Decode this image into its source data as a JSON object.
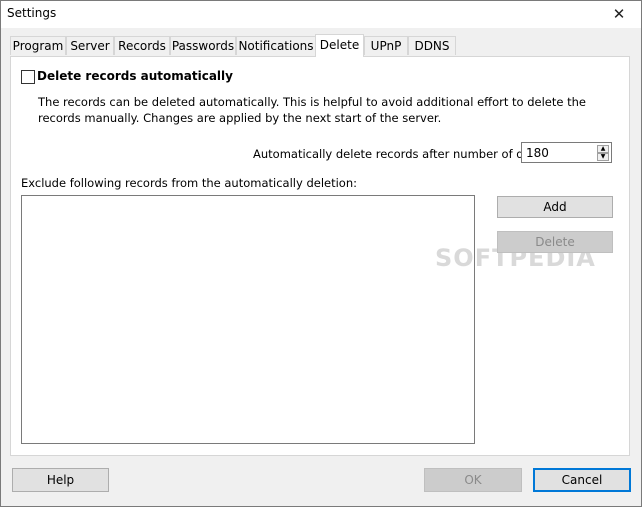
{
  "window": {
    "title": "Settings",
    "close_glyph": "✕"
  },
  "tabs": [
    {
      "label": "Program"
    },
    {
      "label": "Server"
    },
    {
      "label": "Records"
    },
    {
      "label": "Passwords"
    },
    {
      "label": "Notifications"
    },
    {
      "label": "Delete"
    },
    {
      "label": "UPnP"
    },
    {
      "label": "DDNS"
    }
  ],
  "active_tab": "Delete",
  "delete_panel": {
    "auto_delete_label": "Delete records automatically",
    "auto_delete_checked": false,
    "description": "The records can be deleted automatically. This is helpful to avoid additional effort to delete the records manually. Changes are applied by the next start of the server.",
    "days_label": "Automatically delete records after number of days:",
    "days_value": "180",
    "exclude_label": "Exclude following records from the automatically deletion:",
    "add_button": "Add",
    "delete_button": "Delete"
  },
  "watermark": "SOFTPEDIA",
  "footer": {
    "help": "Help",
    "ok": "OK",
    "cancel": "Cancel"
  }
}
